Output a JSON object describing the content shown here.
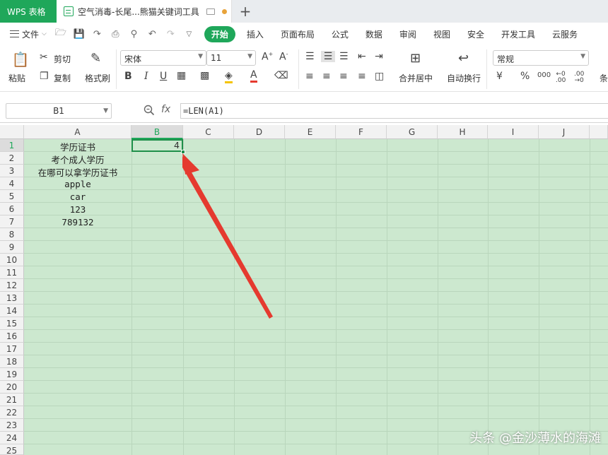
{
  "titlebar": {
    "app_label": "WPS 表格",
    "doc_title": "空气消毒-长尾...熊猫关键词工具",
    "new_tab": "+"
  },
  "menubar": {
    "file_label": "文件",
    "tabs": [
      "开始",
      "插入",
      "页面布局",
      "公式",
      "数据",
      "审阅",
      "视图",
      "安全",
      "开发工具",
      "云服务"
    ]
  },
  "ribbon": {
    "paste": "粘贴",
    "cut": "剪切",
    "copy": "复制",
    "format_painter": "格式刷",
    "font_name": "宋体",
    "font_size": "11",
    "merge_center": "合并居中",
    "wrap_text": "自动换行",
    "number_format": "常规",
    "cond": "条"
  },
  "formula_bar": {
    "name_box": "B1",
    "fx": "fx",
    "formula": "=LEN(A1)"
  },
  "sheet": {
    "columns": [
      "A",
      "B",
      "C",
      "D",
      "E",
      "F",
      "G",
      "H",
      "I",
      "J"
    ],
    "rows": [
      "1",
      "2",
      "3",
      "4",
      "5",
      "6",
      "7",
      "8",
      "9",
      "10",
      "11",
      "12",
      "13",
      "14",
      "15",
      "16",
      "17",
      "18",
      "19",
      "20",
      "21",
      "22",
      "23",
      "24",
      "25"
    ],
    "column_a_values": [
      "学历证书",
      "考个成人学历",
      "在哪可以拿学历证书",
      "apple",
      "car",
      "123",
      "789132"
    ],
    "b1_value": "4"
  },
  "watermark": "头条 @金沙薄水的海滩",
  "colors": {
    "accent": "#1fa75a",
    "sheet_bg": "#cce8cf",
    "arrow": "#e53a2f"
  }
}
